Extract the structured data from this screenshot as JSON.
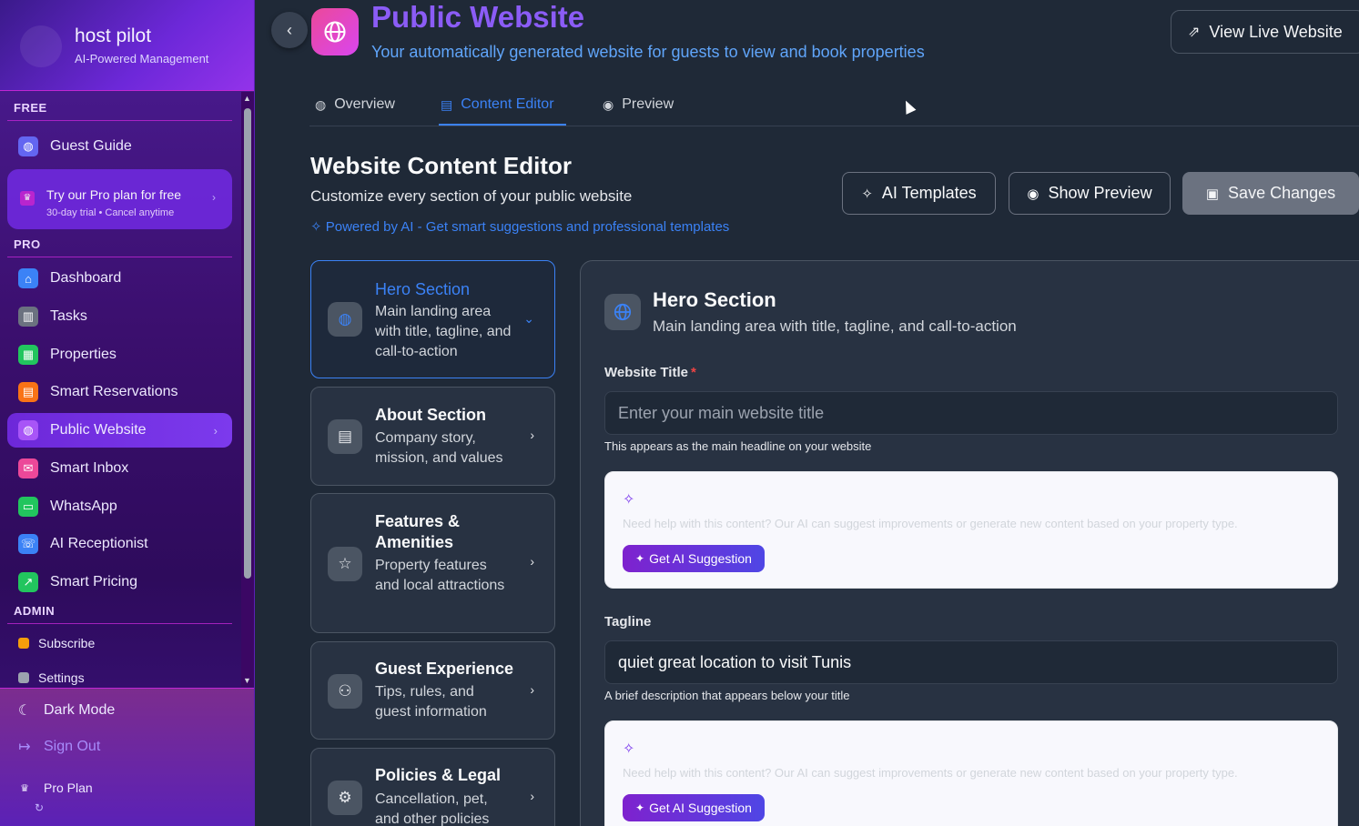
{
  "sidebar": {
    "brand": "host pilot",
    "tagline": "AI-Powered Management",
    "sections": {
      "free": "FREE",
      "pro": "PRO",
      "admin": "ADMIN"
    },
    "free_items": [
      {
        "label": "Guest Guide",
        "icon": "globe-icon"
      }
    ],
    "promo": {
      "title": "Try our Pro plan for free",
      "subtitle": "30-day trial • Cancel anytime"
    },
    "pro_items": [
      {
        "label": "Dashboard",
        "icon": "home-icon",
        "color": "#3b82f6"
      },
      {
        "label": "Tasks",
        "icon": "kanban-icon",
        "color": "#6b7280"
      },
      {
        "label": "Properties",
        "icon": "building-icon",
        "color": "#22c55e"
      },
      {
        "label": "Smart Reservations",
        "icon": "calendar-icon",
        "color": "#f97316"
      },
      {
        "label": "Public Website",
        "icon": "globe-icon",
        "color": "#a855f7",
        "active": true
      },
      {
        "label": "Smart Inbox",
        "icon": "inbox-icon",
        "color": "#ec4899"
      },
      {
        "label": "WhatsApp",
        "icon": "chat-icon",
        "color": "#22c55e"
      },
      {
        "label": "AI Receptionist",
        "icon": "phone-icon",
        "color": "#3b82f6"
      },
      {
        "label": "Smart Pricing",
        "icon": "trend-icon",
        "color": "#22c55e"
      }
    ],
    "admin_items": [
      {
        "label": "Subscribe",
        "icon": "crown-icon",
        "color": "#f59e0b"
      },
      {
        "label": "Settings",
        "icon": "gear-icon",
        "color": "#9ca3af"
      }
    ],
    "footer": {
      "dark_mode": "Dark Mode",
      "sign_out": "Sign Out",
      "plan": "Pro Plan"
    }
  },
  "header": {
    "title": "Public Website",
    "subtitle": "Your automatically generated website for guests to view and book properties",
    "live_button": "View Live Website"
  },
  "tabs": [
    {
      "label": "Overview",
      "icon": "globe-icon"
    },
    {
      "label": "Content Editor",
      "icon": "document-icon",
      "active": true
    },
    {
      "label": "Preview",
      "icon": "eye-icon"
    }
  ],
  "editor": {
    "title": "Website Content Editor",
    "subtitle": "Customize every section of your public website",
    "ai_note": "Powered by AI - Get smart suggestions and professional templates",
    "buttons": {
      "templates": "AI Templates",
      "preview": "Show Preview",
      "save": "Save Changes"
    }
  },
  "sections": [
    {
      "name": "Hero Section",
      "desc": "Main landing area with title, tagline, and call-to-action",
      "icon": "globe-icon",
      "active": true
    },
    {
      "name": "About Section",
      "desc": "Company story, mission, and values",
      "icon": "document-icon"
    },
    {
      "name": "Features & Amenities",
      "desc": "Property features and local attractions",
      "icon": "star-icon"
    },
    {
      "name": "Guest Experience",
      "desc": "Tips, rules, and guest information",
      "icon": "users-icon"
    },
    {
      "name": "Policies & Legal",
      "desc": "Cancellation, pet, and other policies",
      "icon": "gear-icon"
    }
  ],
  "panel": {
    "title": "Hero Section",
    "subtitle": "Main landing area with title, tagline, and call-to-action",
    "fields": [
      {
        "label": "Website Title",
        "required": true,
        "value": "",
        "placeholder": "Enter your main website title",
        "help": "This appears as the main headline on your website"
      },
      {
        "label": "Tagline",
        "required": false,
        "value": "quiet great location to visit Tunis",
        "placeholder": "",
        "help": "A brief description that appears below your title"
      }
    ],
    "ai_help": "Need help with this content? Our AI can suggest improvements or generate new content based on your property type.",
    "ai_button": "Get AI Suggestion"
  }
}
